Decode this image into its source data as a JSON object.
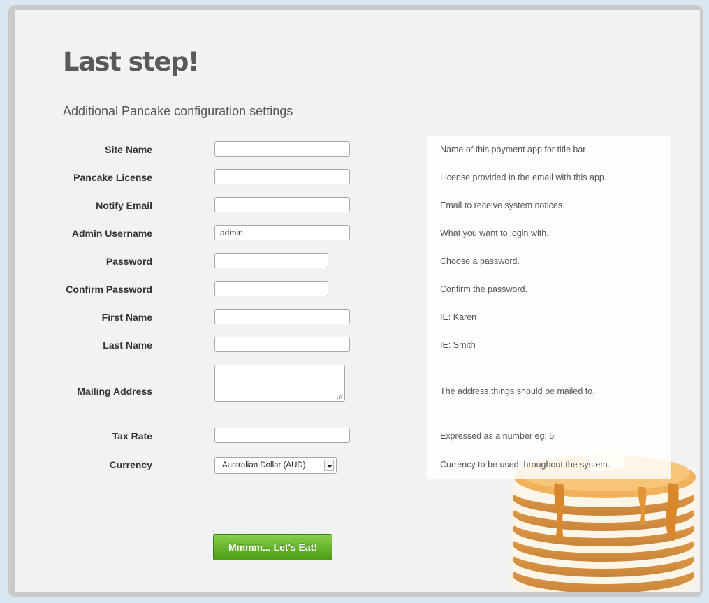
{
  "page": {
    "title": "Last step!",
    "subtitle": "Additional Pancake configuration settings"
  },
  "fields": [
    {
      "label": "Site Name",
      "value": "",
      "help": "Name of this payment app for title bar"
    },
    {
      "label": "Pancake License",
      "value": "",
      "help": "License provided in the email with this app."
    },
    {
      "label": "Notify Email",
      "value": "",
      "help": "Email to receive system notices."
    },
    {
      "label": "Admin Username",
      "value": "admin",
      "help": "What you want to login with."
    },
    {
      "label": "Password",
      "value": "",
      "help": "Choose a password."
    },
    {
      "label": "Confirm Password",
      "value": "",
      "help": "Confirm the password."
    },
    {
      "label": "First Name",
      "value": "",
      "help": "IE: Karen"
    },
    {
      "label": "Last Name",
      "value": "",
      "help": "IE: Smith"
    },
    {
      "label": "Mailing Address",
      "value": "",
      "help": "The address things should be mailed to."
    },
    {
      "label": "Tax Rate",
      "value": "",
      "help": "Expressed as a number eg: 5"
    },
    {
      "label": "Currency",
      "value": "Australian Dollar (AUD)",
      "help": "Currency to be used throughout the system."
    }
  ],
  "submit": {
    "label": "Mmmm... Let's Eat!"
  },
  "colors": {
    "accent": "#5fae22",
    "background": "#f2f2f2",
    "frame": "#c9cbcb"
  },
  "icons": {
    "pancakes": "pancake-stack-illustration",
    "select": "chevron-down-icon",
    "resize": "resize-grip-icon"
  }
}
